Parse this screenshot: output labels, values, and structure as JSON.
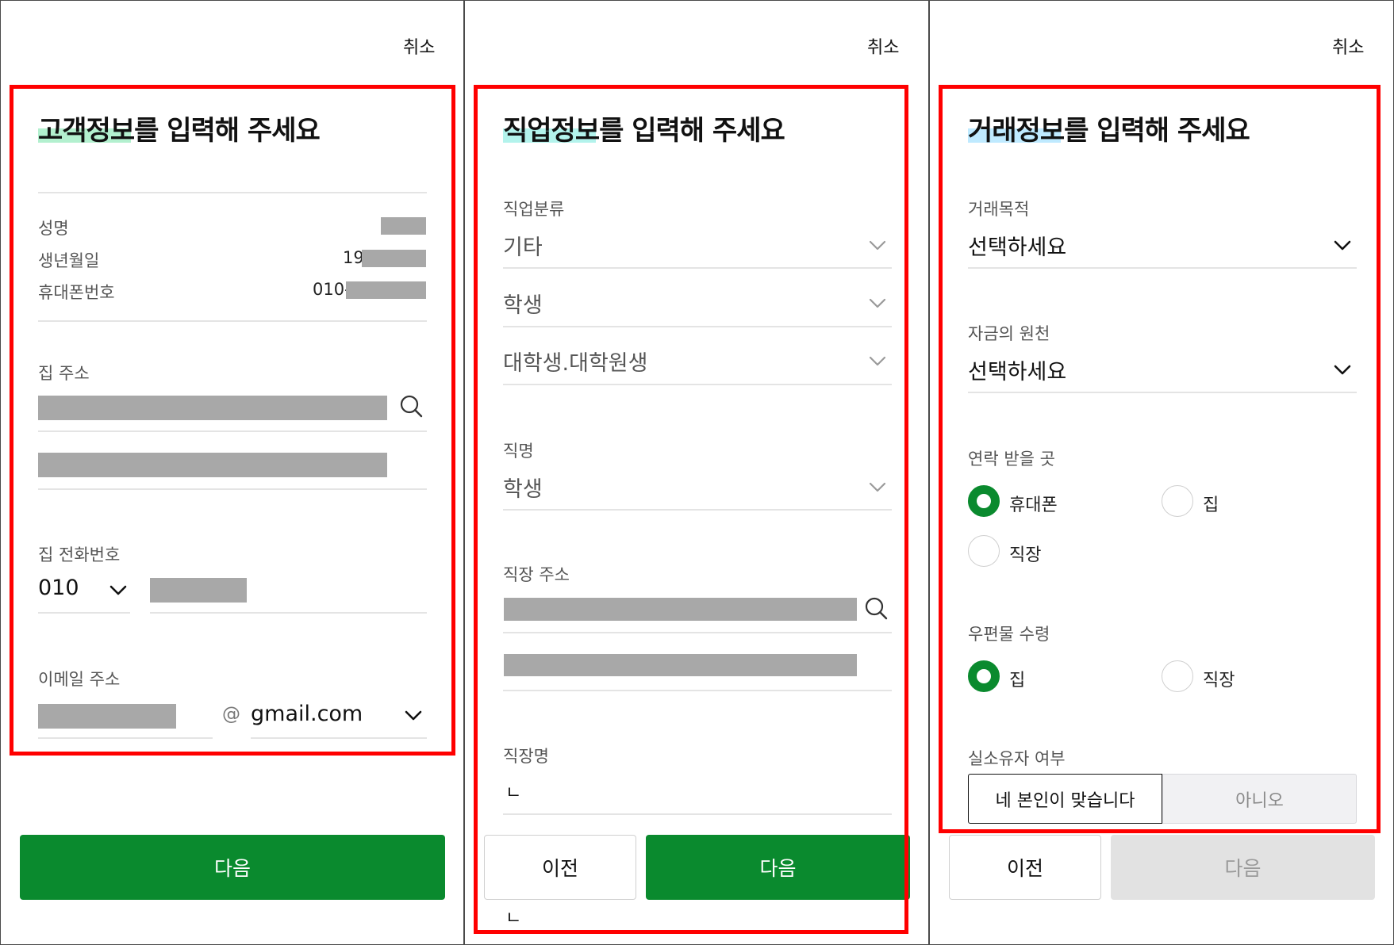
{
  "common": {
    "cancel_label": "취소",
    "next_label": "다음",
    "prev_label": "이전"
  },
  "colors": {
    "primary_green": "#0a8a2e",
    "highlight_box": "#ff0000",
    "redacted": "#a8a8a8"
  },
  "panel1": {
    "title": "고객정보를 입력해 주세요",
    "title_highlight_color": "#b3f0cf",
    "name_label": "성명",
    "birth_label": "생년월일",
    "birth_prefix": "19",
    "phone_label": "휴대폰번호",
    "phone_prefix": "010-",
    "home_address_label": "집 주소",
    "home_phone_label": "집 전화번호",
    "home_phone_area": "010",
    "email_label": "이메일 주소",
    "email_at": "@",
    "email_domain": "gmail.com"
  },
  "panel2": {
    "title": "직업정보를 입력해 주세요",
    "title_highlight_color": "#b3f3ec",
    "job_category_label": "직업분류",
    "job_category_1": "기타",
    "job_category_2": "학생",
    "job_category_3": "대학생.대학원생",
    "job_title_label": "직명",
    "job_title_value": "학생",
    "work_address_label": "직장 주소",
    "workplace_name_label": "직장명",
    "workplace_name_value": "ㄴ",
    "bottom_mark": "ㄴ"
  },
  "panel3": {
    "title": "거래정보를 입력해 주세요",
    "title_highlight_color": "#bfeaff",
    "purpose_label": "거래목적",
    "purpose_value": "선택하세요",
    "fund_source_label": "자금의 원천",
    "fund_source_value": "선택하세요",
    "contact_label": "연락 받을 곳",
    "contact_options": [
      "휴대폰",
      "집",
      "직장"
    ],
    "contact_selected": "휴대폰",
    "mail_label": "우편물 수령",
    "mail_options": [
      "집",
      "직장"
    ],
    "mail_selected": "집",
    "owner_label": "실소유자 여부",
    "owner_yes": "네 본인이 맞습니다",
    "owner_no": "아니오"
  }
}
